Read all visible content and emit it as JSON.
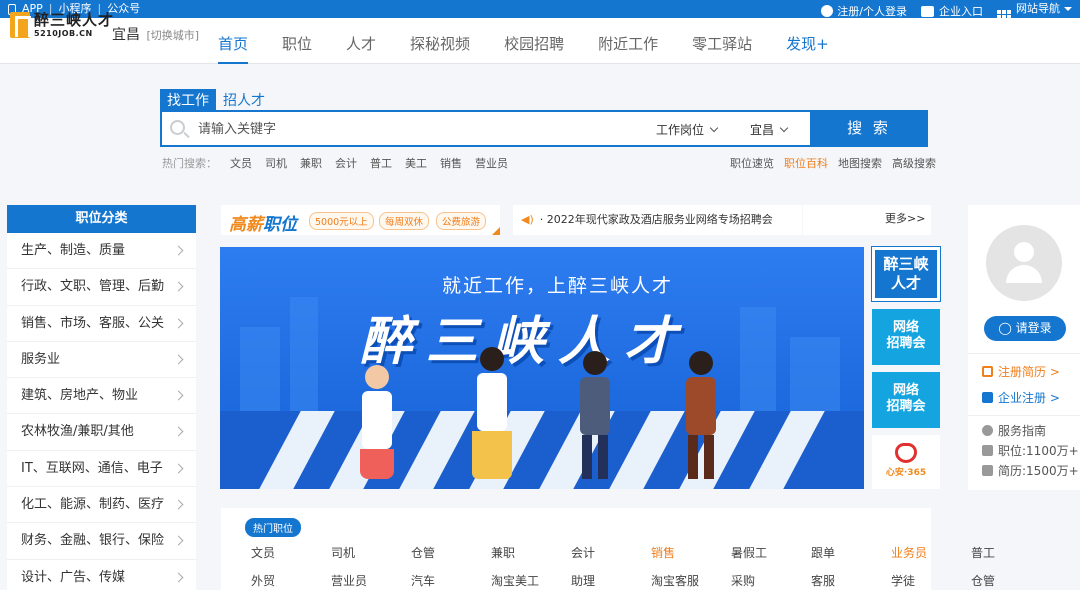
{
  "topbar": {
    "app": "APP",
    "mini": "小程序",
    "gzh": "公众号",
    "register": "注册/个人登录",
    "enterprise": "企业入口",
    "sitenav": "网站导航"
  },
  "logo": {
    "cn": "醉三峡人才",
    "en": "5210JOB.CN"
  },
  "city": {
    "name": "宜昌",
    "switch": "[切换城市]"
  },
  "nav": [
    "首页",
    "职位",
    "人才",
    "探秘视频",
    "校园招聘",
    "附近工作",
    "零工驿站",
    "发现+"
  ],
  "search": {
    "tab_job": "找工作",
    "tab_talent": "招人才",
    "placeholder": "请输入关键字",
    "type": "工作岗位",
    "city": "宜昌",
    "button": "搜 索"
  },
  "hot": {
    "label": "热门搜索：",
    "keys": [
      "文员",
      "司机",
      "兼职",
      "会计",
      "普工",
      "美工",
      "销售",
      "营业员"
    ]
  },
  "quick": [
    "职位速览",
    "职位百科",
    "地图搜索",
    "高级搜索"
  ],
  "category": {
    "title": "职位分类",
    "items": [
      "生产、制造、质量",
      "行政、文职、管理、后勤",
      "销售、市场、客服、公关",
      "服务业",
      "建筑、房地产、物业",
      "农林牧渔/兼职/其他",
      "IT、互联网、通信、电子",
      "化工、能源、制药、医疗",
      "财务、金融、银行、保险",
      "设计、广告、传媒"
    ]
  },
  "promo": {
    "title_a": "高薪",
    "title_b": "职位",
    "tags": [
      "5000元以上",
      "每周双休",
      "公费旅游"
    ]
  },
  "notice": {
    "text": "· 2022年现代家政及酒店服务业网络专场招聘会",
    "more": "更多>>"
  },
  "banner": {
    "sub": "就近工作，上醉三峡人才",
    "title": "醉三峡人才"
  },
  "tiles": {
    "t1": [
      "醉三峡",
      "人才"
    ],
    "t2": [
      "网络",
      "招聘会"
    ],
    "t3": [
      "网络",
      "招聘会"
    ],
    "t4": "心安·365"
  },
  "card": {
    "login": "请登录",
    "reg_resume": "注册简历 >",
    "reg_company": "企业注册 >",
    "guide": "服务指南",
    "jobs": "职位:1100万+",
    "resumes": "简历:1500万+"
  },
  "jobs": {
    "badge": "热门职位",
    "row1": [
      "文员",
      "司机",
      "仓管",
      "兼职",
      "会计",
      "销售",
      "暑假工",
      "跟单",
      "业务员",
      "普工"
    ],
    "row2": [
      "外贸",
      "营业员",
      "汽车",
      "淘宝美工",
      "助理",
      "淘宝客服",
      "采购",
      "客服",
      "学徒",
      "仓管"
    ]
  },
  "colors": {
    "primary": "#1576cf",
    "accent": "#f07e1b"
  }
}
